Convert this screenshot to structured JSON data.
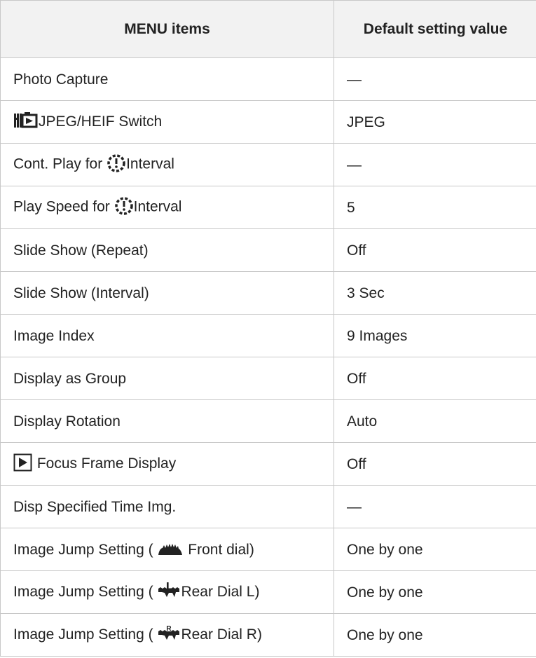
{
  "table": {
    "headers": [
      "MENU items",
      "Default setting value"
    ],
    "rows": [
      {
        "item": "Photo Capture",
        "value": "—"
      },
      {
        "item_icon": "jpeg-heif-switch-icon",
        "item": "JPEG/HEIF Switch",
        "value": "JPEG"
      },
      {
        "item_prefix": "Cont. Play for",
        "item_icon": "interval-shooting-icon",
        "item_suffix": "Interval",
        "value": "—"
      },
      {
        "item_prefix": "Play Speed for",
        "item_icon": "interval-shooting-icon",
        "item_suffix": "Interval",
        "value": "5"
      },
      {
        "item": "Slide Show (Repeat)",
        "value": "Off"
      },
      {
        "item": "Slide Show (Interval)",
        "value": "3 Sec"
      },
      {
        "item": "Image Index",
        "value": "9 Images"
      },
      {
        "item": "Display as Group",
        "value": "Off"
      },
      {
        "item": "Display Rotation",
        "value": "Auto"
      },
      {
        "item_icon": "playback-icon",
        "item": "Focus Frame Display",
        "value": "Off"
      },
      {
        "item": "Disp Specified Time Img.",
        "value": "—"
      },
      {
        "item_prefix": "Image Jump Setting (",
        "item_icon": "front-dial-icon",
        "item_suffix": "Front dial)",
        "value": "One by one"
      },
      {
        "item_prefix": "Image Jump Setting (",
        "item_icon": "rear-dial-l-icon",
        "item_suffix": "Rear Dial L)",
        "value": "One by one"
      },
      {
        "item_prefix": "Image Jump Setting (",
        "item_icon": "rear-dial-r-icon",
        "item_suffix": "Rear Dial R)",
        "value": "One by one"
      }
    ]
  }
}
